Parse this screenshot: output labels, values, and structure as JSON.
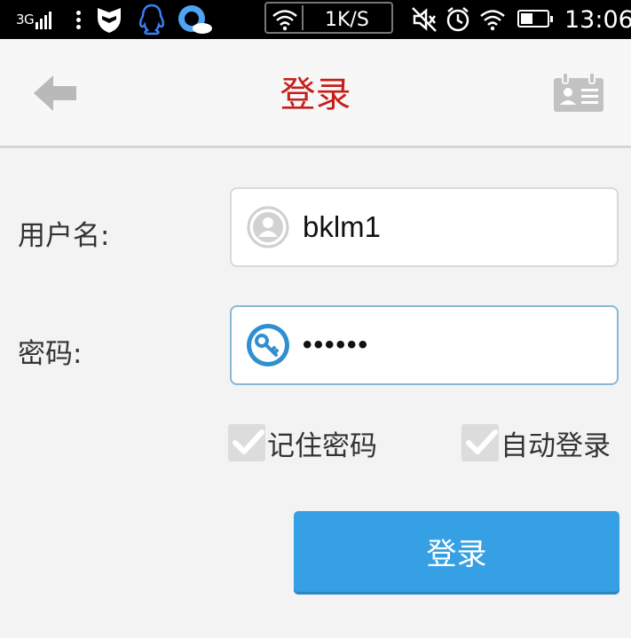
{
  "status_bar": {
    "network_type": "3G",
    "net_speed": "1K/S",
    "time": "13:06",
    "icons": [
      "signal-icon",
      "menu-dots-icon",
      "shield-icon",
      "qq-icon",
      "browser-icon",
      "wifi-icon",
      "mute-icon",
      "alarm-icon",
      "wifi-icon",
      "battery-icon"
    ]
  },
  "header": {
    "title": "登录",
    "back_icon": "back-arrow-icon",
    "card_icon": "id-card-icon"
  },
  "form": {
    "username_label": "用户名:",
    "username_value": "bklm1",
    "password_label": "密码:",
    "password_value": "••••••",
    "remember_password_label": "记住密码",
    "auto_login_label": "自动登录",
    "remember_password_checked": true,
    "auto_login_checked": true,
    "submit_label": "登录"
  },
  "colors": {
    "title": "#c61f1a",
    "button": "#36a0e5",
    "key_icon": "#2f8fd1"
  }
}
